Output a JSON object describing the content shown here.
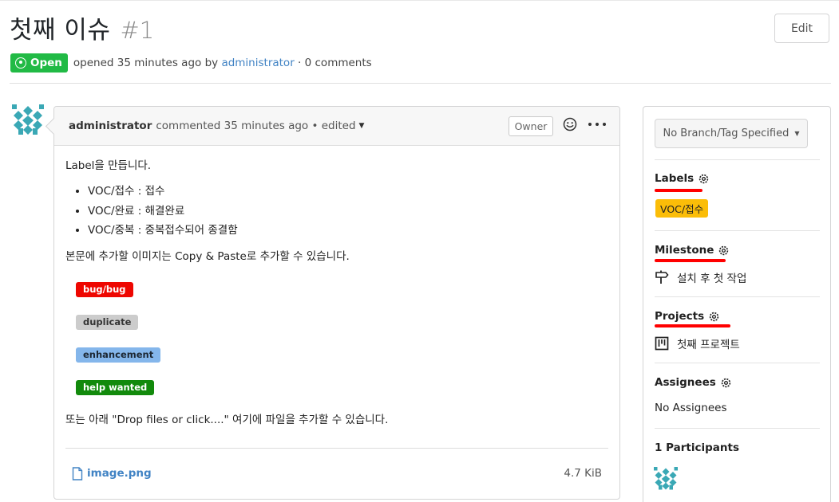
{
  "issue": {
    "title": "첫째 이슈",
    "number": "#1",
    "edit_label": "Edit",
    "status": "Open",
    "opened_text": "opened 35 minutes ago by",
    "author": "administrator",
    "comments_text": "· 0 comments"
  },
  "comment": {
    "author": "administrator",
    "meta": "commented 35 minutes ago • edited",
    "owner_tag": "Owner",
    "icons": [
      "smiley-icon",
      "more-horizontal-icon",
      "dropdown-caret-icon"
    ],
    "intro": "Label을 만듭니다.",
    "list": [
      "VOC/접수 : 접수",
      "VOC/완료 : 해결완료",
      "VOC/중복 : 중복접수되어 종결함"
    ],
    "paste_text": "본문에 추가할 이미지는 Copy & Paste로 추가할 수 있습니다.",
    "labels": [
      {
        "name": "bug/bug",
        "bg": "#ee0701",
        "fg": "#ffffff"
      },
      {
        "name": "duplicate",
        "bg": "#cccccc",
        "fg": "#333333"
      },
      {
        "name": "enhancement",
        "bg": "#84b6eb",
        "fg": "#1c2733"
      },
      {
        "name": "help wanted",
        "bg": "#128a0c",
        "fg": "#ffffff"
      }
    ],
    "drop_text": "또는 아래 \"Drop files or click....\" 여기에 파일을 추가할 수 있습니다.",
    "attachment": {
      "name": "image.png",
      "size": "4.7 KiB",
      "icon": "file-icon"
    }
  },
  "sidebar": {
    "branch": "No Branch/Tag Specified",
    "labels_title": "Labels",
    "label_value": "VOC/접수",
    "label_color": "#fbbd08",
    "milestone_title": "Milestone",
    "milestone_value": "설치 후 첫 작업",
    "projects_title": "Projects",
    "project_value": "첫째 프로젝트",
    "assignees_title": "Assignees",
    "assignees_value": "No Assignees",
    "participants_title": "1 Participants"
  },
  "colors": {
    "open_green": "#21ba45",
    "link_blue": "#4183c4",
    "annotation_red": "#ff0000"
  }
}
